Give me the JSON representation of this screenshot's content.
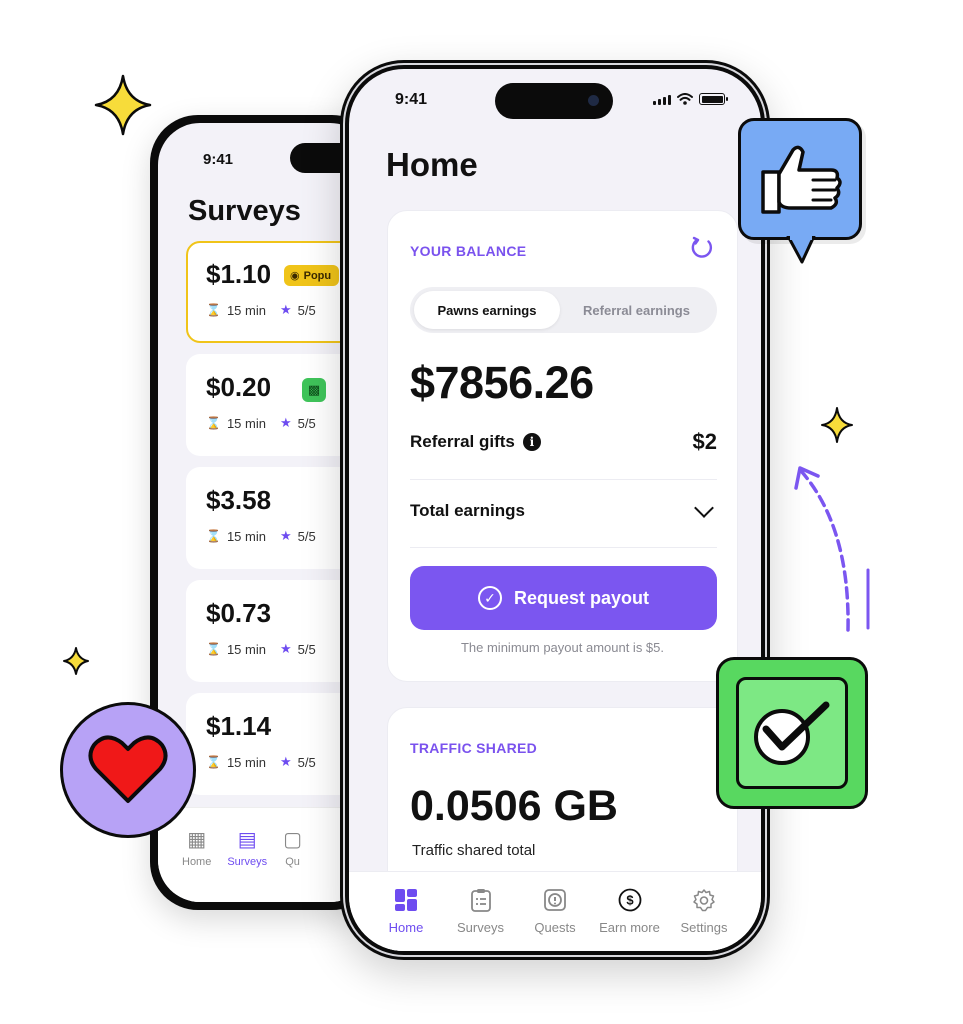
{
  "back_phone": {
    "status_time": "9:41",
    "title": "Surveys",
    "surveys": [
      {
        "price": "$1.10",
        "badge": "Popu",
        "duration": "15 min",
        "rating": "5/5"
      },
      {
        "price": "$0.20",
        "duration": "15 min",
        "rating": "5/5"
      },
      {
        "price": "$3.58",
        "duration": "15 min",
        "rating": "5/5"
      },
      {
        "price": "$0.73",
        "duration": "15 min",
        "rating": "5/5"
      },
      {
        "price": "$1.14",
        "duration": "15 min",
        "rating": "5/5"
      }
    ],
    "tabs": [
      {
        "label": "Home",
        "icon": "grid-icon"
      },
      {
        "label": "Surveys",
        "icon": "clipboard-icon"
      },
      {
        "label": "Qu",
        "icon": "quest-icon"
      }
    ]
  },
  "front_phone": {
    "status_time": "9:41",
    "title": "Home",
    "balance_card": {
      "label": "YOUR BALANCE",
      "segments": [
        "Pawns earnings",
        "Referral earnings"
      ],
      "selected_segment": "Pawns earnings",
      "amount": "$7856.26",
      "referral_label": "Referral gifts",
      "referral_value": "$2",
      "info_glyph": "i",
      "total_label": "Total earnings",
      "payout_button": "Request payout",
      "payout_note": "The minimum payout amount is $5."
    },
    "traffic_card": {
      "label": "TRAFFIC SHARED",
      "amount": "0.0506 GB",
      "subtitle": "Traffic shared total"
    },
    "tabs": [
      {
        "label": "Home",
        "icon": "home-grid-icon",
        "active": true
      },
      {
        "label": "Surveys",
        "icon": "clipboard-icon",
        "active": false
      },
      {
        "label": "Quests",
        "icon": "quest-icon",
        "active": false
      },
      {
        "label": "Earn more",
        "icon": "dollar-icon",
        "active": false
      },
      {
        "label": "Settings",
        "icon": "gear-icon",
        "active": false
      }
    ]
  },
  "colors": {
    "accent": "#7b56f0",
    "popular_badge": "#f0c419",
    "thumbs_sticker": "#78aaf4",
    "check_sticker": "#58d860",
    "heart_sticker": "#b7a2f6",
    "heart": "#f01818"
  }
}
